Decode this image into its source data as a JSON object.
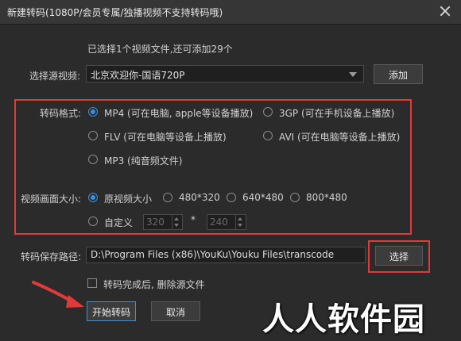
{
  "window": {
    "title": "新建转码(1080P/会员专属/独播视频不支持转码哦)"
  },
  "source": {
    "info": "已选择1个视频文件,还可添加29个",
    "label": "选择源视频:",
    "selected": "北京欢迎你-国语720P",
    "add_button": "添加"
  },
  "format": {
    "label": "转码格式:",
    "options": [
      {
        "label": "MP4 (可在电脑, apple等设备播放)",
        "selected": true
      },
      {
        "label": "3GP  (可在手机设备上播放)",
        "selected": false
      },
      {
        "label": "FLV  (可在电脑等设备上播放)",
        "selected": false
      },
      {
        "label": "AVI  (可在电脑等设备上播放)",
        "selected": false
      },
      {
        "label": "MP3 (纯音频文件)",
        "selected": false
      }
    ]
  },
  "size": {
    "label": "视频画面大小:",
    "options": [
      {
        "label": "原视频大小",
        "selected": true
      },
      {
        "label": "480*320",
        "selected": false
      },
      {
        "label": "640*480",
        "selected": false
      },
      {
        "label": "800*480",
        "selected": false
      }
    ],
    "custom_label": "自定义",
    "custom_width": "320",
    "custom_height": "240",
    "separator": "*"
  },
  "save": {
    "label": "转码保存路径:",
    "path": "D:\\Program Files (x86)\\YouKu\\Youku Files\\transcode",
    "choose_button": "选择"
  },
  "options": {
    "delete_source_label": "转码完成后, 删除源文件",
    "delete_source_checked": false
  },
  "actions": {
    "start_label": "开始转码",
    "cancel_label": "取消"
  },
  "watermark": "人人软件园",
  "colors": {
    "annotation_red": "#e23a3a",
    "accent_blue": "#3b8fe0"
  }
}
